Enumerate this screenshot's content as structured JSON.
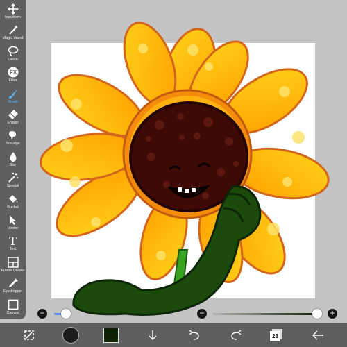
{
  "toolbar": {
    "tools": [
      {
        "label": "transform",
        "icon": "transform-icon"
      },
      {
        "label": "Magic Wand",
        "icon": "magic-wand-icon"
      },
      {
        "label": "Lasso",
        "icon": "lasso-icon"
      },
      {
        "label": "Filter",
        "icon": "fx-icon",
        "glyph": "FX"
      },
      {
        "label": "Brush",
        "icon": "brush-icon",
        "active": true
      },
      {
        "label": "Eraser",
        "icon": "eraser-icon"
      },
      {
        "label": "Smudge",
        "icon": "smudge-icon"
      },
      {
        "label": "Blur",
        "icon": "blur-icon"
      },
      {
        "label": "Special",
        "icon": "special-icon"
      },
      {
        "label": "Bucket",
        "icon": "bucket-icon"
      },
      {
        "label": "Vector",
        "icon": "vector-icon"
      },
      {
        "label": "Text",
        "icon": "text-icon",
        "glyph": "T"
      },
      {
        "label": "Frame Divider",
        "icon": "frame-divider-icon"
      },
      {
        "label": "Eyedropper",
        "icon": "eyedropper-icon"
      },
      {
        "label": "Canvas",
        "icon": "canvas-icon"
      }
    ],
    "active_color": "#57b6ff"
  },
  "brush_size_slider": {
    "minus": "−",
    "level": 0.1
  },
  "opacity_slider": {
    "minus": "−",
    "plus": "+",
    "level": 0.97
  },
  "bottombar": {
    "current_color": "#102205",
    "layer_count": "23"
  }
}
